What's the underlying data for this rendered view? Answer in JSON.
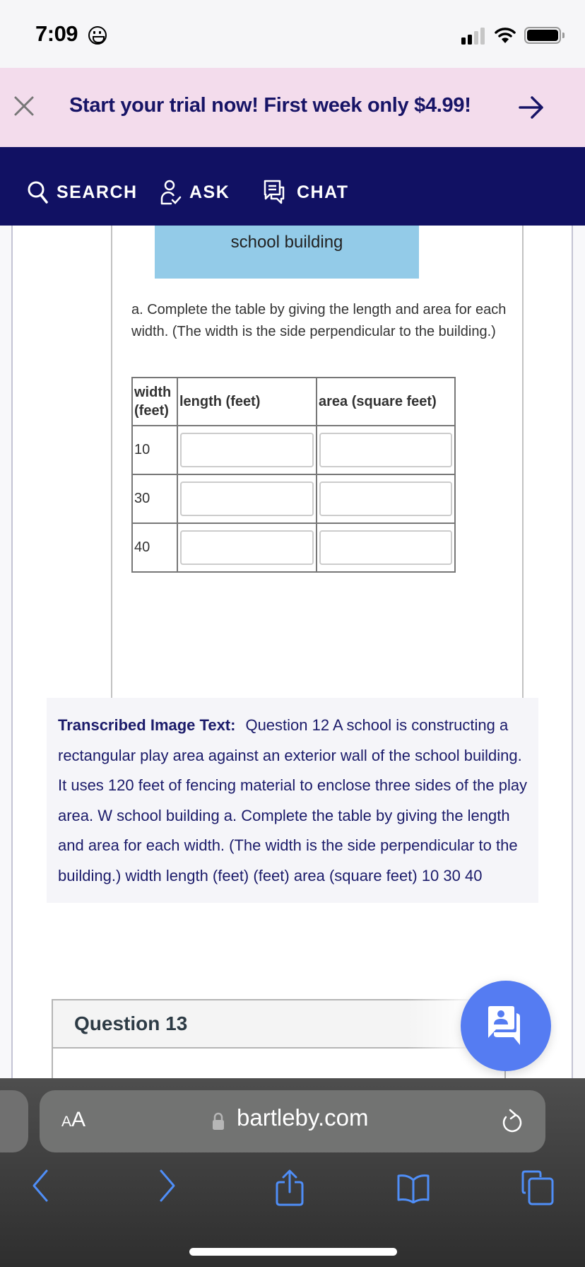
{
  "status_bar": {
    "time": "7:09",
    "emoji_icon": "smiley-face-icon",
    "signal_bars_filled": 2,
    "signal_bars_total": 4,
    "wifi_icon": "wifi-icon",
    "battery_level": 1.0
  },
  "promo": {
    "close_icon": "close-icon",
    "text": "Start your trial now! First week only $4.99!",
    "arrow_icon": "arrow-right-icon"
  },
  "nav": {
    "items": [
      {
        "label": "SEARCH",
        "icon": "search-icon"
      },
      {
        "label": "ASK",
        "icon": "person-check-icon"
      },
      {
        "label": "CHAT",
        "icon": "chat-bubbles-icon"
      }
    ]
  },
  "question_image": {
    "building_label": "school building",
    "instruction": "a. Complete the table by giving the length and area for each width. (The width is the side perpendicular to the building.)",
    "table": {
      "headers": [
        "width (feet)",
        "length (feet)",
        "area (square feet)"
      ],
      "rows": [
        {
          "width": "10",
          "length": "",
          "area": ""
        },
        {
          "width": "30",
          "length": "",
          "area": ""
        },
        {
          "width": "40",
          "length": "",
          "area": ""
        }
      ]
    }
  },
  "transcript": {
    "label": "Transcribed Image Text:",
    "text": "Question 12 A school is constructing a rectangular play area against an exterior wall of the school building. It uses 120 feet of fencing material to enclose three sides of the play area. W school building a. Complete the table by giving the length and area for each width. (The width is the side perpendicular to the building.) width length (feet) (feet) area (square feet) 10 30 40"
  },
  "next_question": {
    "title": "Question 13"
  },
  "chat_fab": {
    "icon": "tutor-chat-icon"
  },
  "browser": {
    "text_size_label": "AA",
    "url": "bartleby.com",
    "lock_icon": "lock-icon",
    "reload_icon": "reload-icon",
    "toolbar": [
      "back-icon",
      "forward-icon",
      "share-icon",
      "bookmarks-icon",
      "tabs-icon"
    ],
    "accent_color": "#4f8ef7"
  },
  "colors": {
    "nav_bg": "#111163",
    "promo_bg": "#f3dcec",
    "promo_text": "#171466",
    "building_fill": "#93cbe8",
    "fab_bg": "#557cf2"
  }
}
